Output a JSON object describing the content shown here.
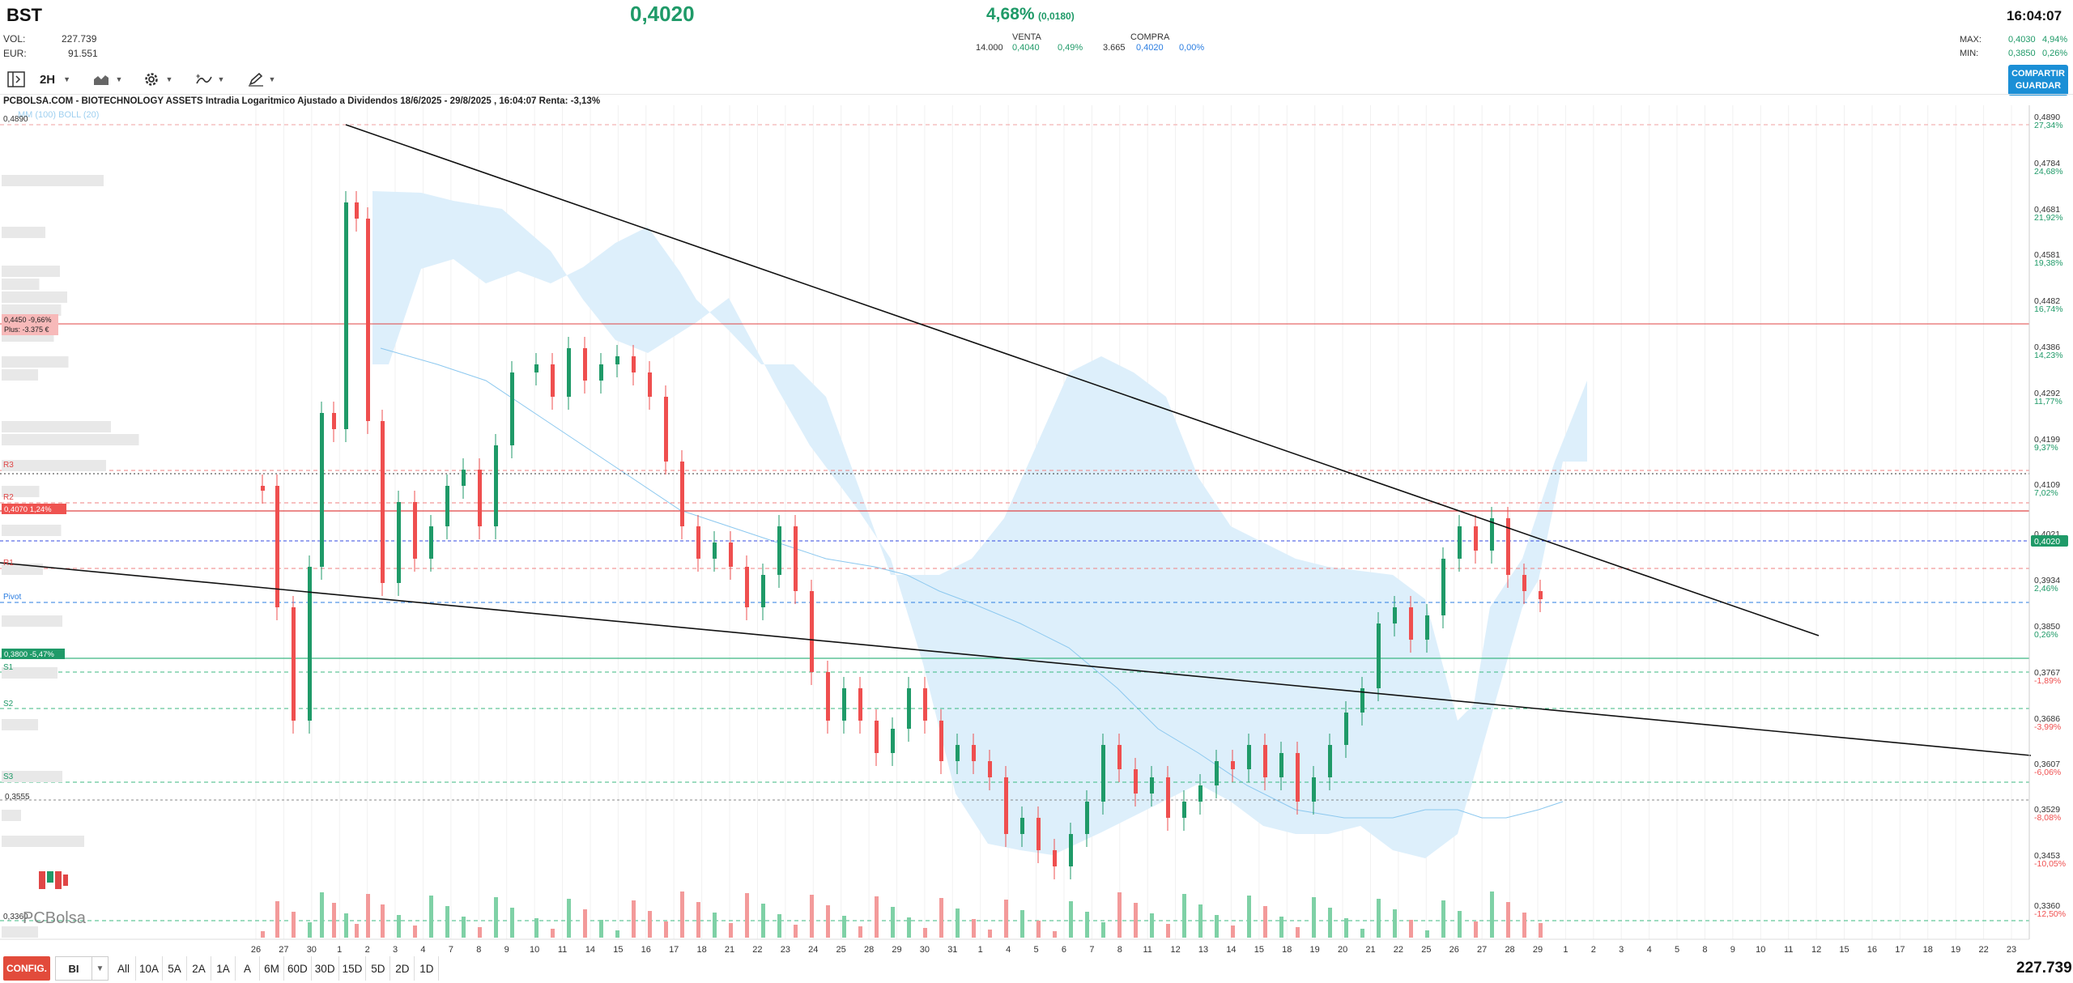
{
  "header": {
    "symbol": "BST",
    "vol_label": "VOL:",
    "vol_value": "227.739",
    "eur_label": "EUR:",
    "eur_value": "91.551",
    "price": "0,4020",
    "change_pct": "4,68%",
    "change_abs": "(0,0180)",
    "clock": "16:04:07",
    "sell": {
      "label": "VENTA",
      "qty": "14.000",
      "price": "0,4040",
      "pct": "0,49%"
    },
    "buy": {
      "label": "COMPRA",
      "qty": "3.665",
      "price": "0,4020",
      "pct": "0,00%"
    },
    "max_label": "MAX:",
    "max_value": "0,4030",
    "max_pct": "4,94%",
    "min_label": "MIN:",
    "min_value": "0,3850",
    "min_pct": "0,26%"
  },
  "toolbar": {
    "interval": "2H",
    "share_label": "COMPARTIR",
    "save_label": "GUARDAR"
  },
  "chart": {
    "title": "PCBOLSA.COM - BIOTECHNOLOGY ASSETS Intradia Logaritmico Ajustado a Dividendos 18/6/2025 - 29/8/2025 , 16:04:07 Renta: -3,13%",
    "indicator": "MM (100) BOLL (20)",
    "top_left_price": "0,4890",
    "bottom_left_price": "0,3360",
    "level_3555": "0,3555",
    "tag_4450": "0,4450 -9,66%",
    "tag_plus": "Plus: -3.375 €",
    "tag_4070": "0,4070  1,24%",
    "tag_3800": "0,3800  -5,47%",
    "pivots": {
      "r3": "R3",
      "r2": "R2",
      "r1": "R1",
      "pivot": "Pivot",
      "s1": "S1",
      "s2": "S2",
      "s3": "S3"
    },
    "logo": "PCBolsa",
    "current_tag": "0,4020",
    "right_axis": [
      {
        "p": "0,4890",
        "r": "27,34%",
        "up": true
      },
      {
        "p": "0,4784",
        "r": "24,68%",
        "up": true
      },
      {
        "p": "0,4681",
        "r": "21,92%",
        "up": true
      },
      {
        "p": "0,4581",
        "r": "19,38%",
        "up": true
      },
      {
        "p": "0,4482",
        "r": "16,74%",
        "up": true
      },
      {
        "p": "0,4386",
        "r": "14,23%",
        "up": true
      },
      {
        "p": "0,4292",
        "r": "11,77%",
        "up": true
      },
      {
        "p": "0,4199",
        "r": "9,37%",
        "up": true
      },
      {
        "p": "0,4109",
        "r": "7,02%",
        "up": true
      },
      {
        "p": "0,4021",
        "r": "",
        "up": true
      },
      {
        "p": "0,3934",
        "r": "2,46%",
        "up": true
      },
      {
        "p": "0,3850",
        "r": "0,26%",
        "up": true
      },
      {
        "p": "0,3767",
        "r": "-1,89%",
        "up": false
      },
      {
        "p": "0,3686",
        "r": "-3,99%",
        "up": false
      },
      {
        "p": "0,3607",
        "r": "-6,06%",
        "up": false
      },
      {
        "p": "0,3529",
        "r": "-8,08%",
        "up": false
      },
      {
        "p": "0,3453",
        "r": "-10,05%",
        "up": false
      },
      {
        "p": "0,3360",
        "r": "-12,50%",
        "up": false
      }
    ],
    "x_labels": [
      "26",
      "27",
      "30",
      "1",
      "2",
      "3",
      "4",
      "7",
      "8",
      "9",
      "10",
      "11",
      "14",
      "15",
      "16",
      "17",
      "18",
      "21",
      "22",
      "23",
      "24",
      "25",
      "28",
      "29",
      "30",
      "31",
      "1",
      "4",
      "5",
      "6",
      "7",
      "8",
      "11",
      "12",
      "13",
      "14",
      "15",
      "18",
      "19",
      "20",
      "21",
      "22",
      "25",
      "26",
      "27",
      "28",
      "29",
      "1",
      "2",
      "3",
      "4",
      "5",
      "8",
      "9",
      "10",
      "11",
      "12",
      "15",
      "16",
      "17",
      "18",
      "19",
      "22",
      "23"
    ]
  },
  "bottom": {
    "config_label": "CONFIG.",
    "select_value": "BI",
    "ranges": [
      "All",
      "10A",
      "5A",
      "2A",
      "1A",
      "A",
      "6M",
      "60D",
      "30D",
      "15D",
      "5D",
      "2D",
      "1D"
    ],
    "volume_total": "227.739"
  },
  "colors": {
    "up": "#1f9a68",
    "down": "#ef4f4f",
    "band": "#dcefff",
    "accent": "#1b8fd6"
  }
}
